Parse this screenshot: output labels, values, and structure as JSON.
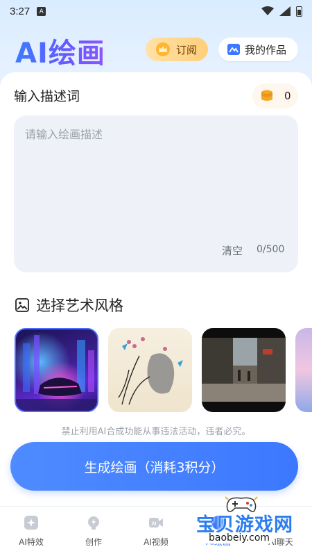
{
  "status_bar": {
    "time": "3:27",
    "notification_badge": "A",
    "icons": [
      "wifi-icon",
      "signal-icon",
      "battery-icon"
    ]
  },
  "header": {
    "title": "AI绘画",
    "subscribe_label": "订阅",
    "works_label": "我的作品"
  },
  "prompt": {
    "section_label": "输入描述词",
    "points": "0",
    "placeholder": "请输入绘画描述",
    "value": "",
    "clear_label": "清空",
    "char_count": "0/500"
  },
  "style": {
    "heading": "选择艺术风格",
    "options": [
      {
        "name": "neon-city",
        "selected": true
      },
      {
        "name": "ink-painting",
        "selected": false
      },
      {
        "name": "street-photo",
        "selected": false
      },
      {
        "name": "anime",
        "selected": false
      }
    ]
  },
  "notice": "禁止利用AI合成功能从事违法活动，违者必究。",
  "generate_button": "生成绘画（消耗3积分）",
  "bottom_nav": {
    "items": [
      {
        "label": "AI特效",
        "icon": "sparkle-icon"
      },
      {
        "label": "创作",
        "icon": "lightbulb-icon"
      },
      {
        "label": "AI视频",
        "icon": "video-icon"
      },
      {
        "label": "AI绘画",
        "icon": "palette-icon"
      },
      {
        "label": "AI聊天",
        "icon": "chat-icon"
      }
    ]
  },
  "watermark": {
    "text": "宝贝游戏网",
    "url": "baobeiy.com"
  },
  "colors": {
    "accent": "#3c78ff",
    "subscribe_bg": "#ffd58a",
    "prompt_bg": "#eef2f8"
  }
}
